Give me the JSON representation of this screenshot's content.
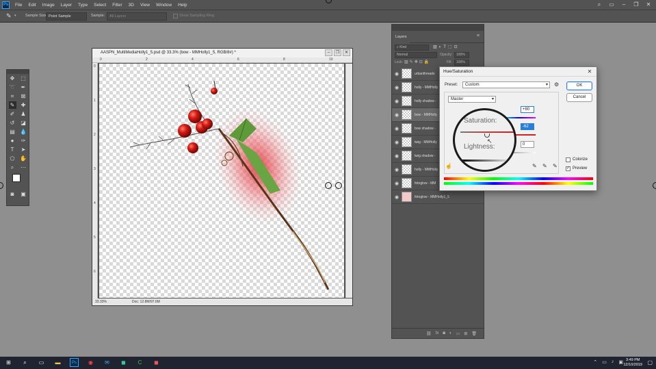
{
  "app": {
    "logo_text": "Ps",
    "menu": [
      "File",
      "Edit",
      "Image",
      "Layer",
      "Type",
      "Select",
      "Filter",
      "3D",
      "View",
      "Window",
      "Help"
    ]
  },
  "options_bar": {
    "sample_size_label": "Sample Size:",
    "sample_size_value": "Point Sample",
    "sample_label": "Sample:",
    "sample_value": "All Layers",
    "show_sampling_ring": "Show Sampling Ring"
  },
  "document": {
    "title": "AASPN_MultiMediaHolly1_5.psd @ 33.3% (bow - MMHolly1_5, RGB/8#) *",
    "ruler_top": [
      "0",
      "1",
      "2",
      "3",
      "4",
      "5",
      "6",
      "7",
      "8",
      "9",
      "10",
      "11",
      "12"
    ],
    "ruler_left": [
      "0",
      "1",
      "2",
      "3",
      "4",
      "5",
      "6",
      "7",
      "8",
      "9",
      "10",
      "11"
    ],
    "zoom": "33.33%",
    "doc_size": "Doc: 12.8M/97.6M"
  },
  "layers_panel": {
    "tab_label": "Layers",
    "kind_label": "Kind",
    "blend_mode": "Normal",
    "opacity_label": "Opacity:",
    "opacity_value": "100%",
    "lock_label": "Lock:",
    "fill_label": "Fill:",
    "fill_value": "100%",
    "layers": [
      {
        "name": "urbanthreads"
      },
      {
        "name": "holly - MMHolly"
      },
      {
        "name": "holly shadow -"
      },
      {
        "name": "bow - MMHolly"
      },
      {
        "name": "bow shadow -"
      },
      {
        "name": "twig - MMHolly"
      },
      {
        "name": "twig shadow -"
      },
      {
        "name": "holly - MMHolly"
      },
      {
        "name": "fotoglow - MM"
      },
      {
        "name": "fotoglow - MMHolly1_5"
      }
    ]
  },
  "hue_saturation": {
    "title": "Hue/Saturation",
    "preset_label": "Preset:",
    "preset_value": "Custom",
    "channel_value": "Master",
    "hue_value": "+80",
    "saturation_label": "Saturation:",
    "saturation_value": "-62",
    "lightness_label": "Lightness:",
    "lightness_value": "0",
    "ok_label": "OK",
    "cancel_label": "Cancel",
    "colorize_label": "Colorize",
    "preview_label": "Preview",
    "preview_checked": true,
    "colorize_checked": false
  },
  "taskbar": {
    "time": "3:49 PM",
    "date": "12/10/2019"
  }
}
